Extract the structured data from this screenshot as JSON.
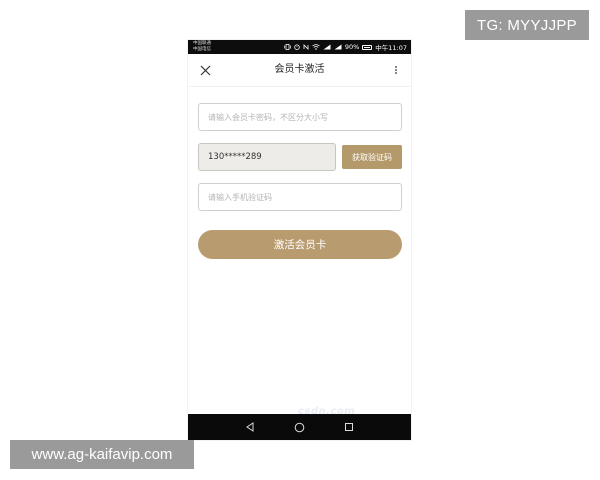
{
  "status_bar": {
    "carrier_1": "中国联通",
    "carrier_2": "中国电信",
    "battery": "90%",
    "time": "中午11:07"
  },
  "nav": {
    "title": "会员卡激活",
    "close_icon": "close-icon",
    "more_icon": "more-vertical-icon"
  },
  "form": {
    "card_password_placeholder": "请输入会员卡密码，不区分大小写",
    "phone_value": "130*****289",
    "get_code_label": "获取验证码",
    "sms_code_placeholder": "请输入手机验证码",
    "activate_label": "激活会员卡"
  },
  "android_nav": {
    "back_icon": "back-triangle-icon",
    "home_icon": "home-circle-icon",
    "recent_icon": "recent-square-icon"
  },
  "watermark": "csdn.com",
  "overlays": {
    "tg": "TG: MYYJJPP",
    "site": "www.ag-kaifavip.com"
  },
  "colors": {
    "accent": "#b89c6f",
    "status_bar": "#0d0d0d",
    "overlay": "#9a9a9a"
  }
}
